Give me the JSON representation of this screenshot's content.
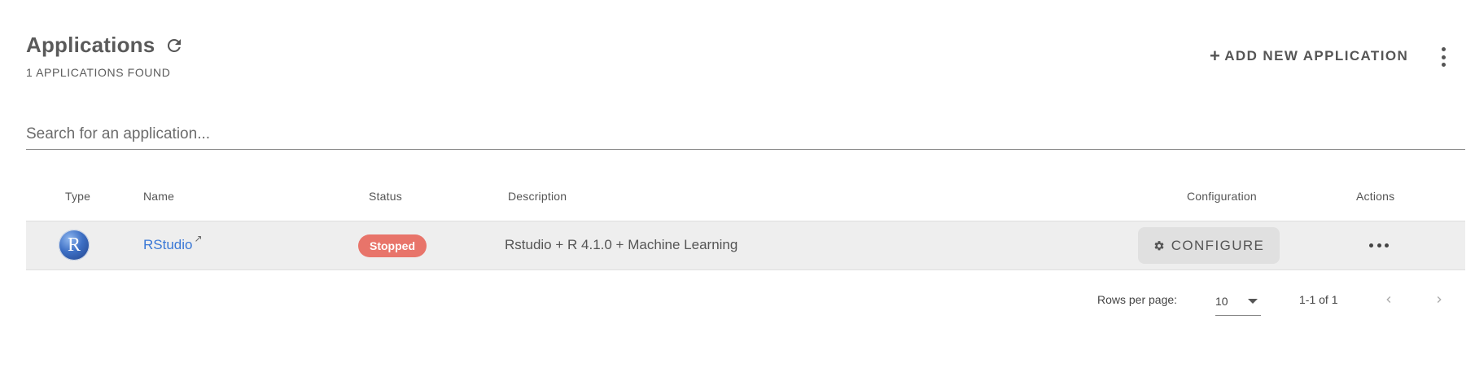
{
  "header": {
    "title": "Applications",
    "count": "1 APPLICATIONS FOUND",
    "refresh_icon": "refresh-icon"
  },
  "toolbar": {
    "add_label": "ADD NEW APPLICATION",
    "add_icon": "+",
    "menu_icon": "more-vert-icon"
  },
  "search": {
    "placeholder": "Search for an application...",
    "value": ""
  },
  "table": {
    "columns": [
      "Type",
      "Name",
      "Status",
      "Description",
      "Configuration",
      "Actions"
    ],
    "rows": [
      {
        "type_icon": "rstudio-logo",
        "logo_letter": "R",
        "name": "RStudio",
        "name_link_icon": "external-link-icon",
        "status": "Stopped",
        "description": "Rstudio + R 4.1.0 + Machine Learning",
        "configure_label": "CONFIGURE",
        "configure_icon": "gear-icon",
        "actions_icon": "more-horiz-icon"
      }
    ]
  },
  "pagination": {
    "rows_per_page_label": "Rows per page:",
    "rows_per_page_value": "10",
    "range": "1-1 of 1"
  },
  "colors": {
    "link": "#3a78d6",
    "status_stopped": "#e8746a",
    "row_bg": "#eeeeee",
    "button_bg": "#e0e0e0"
  }
}
